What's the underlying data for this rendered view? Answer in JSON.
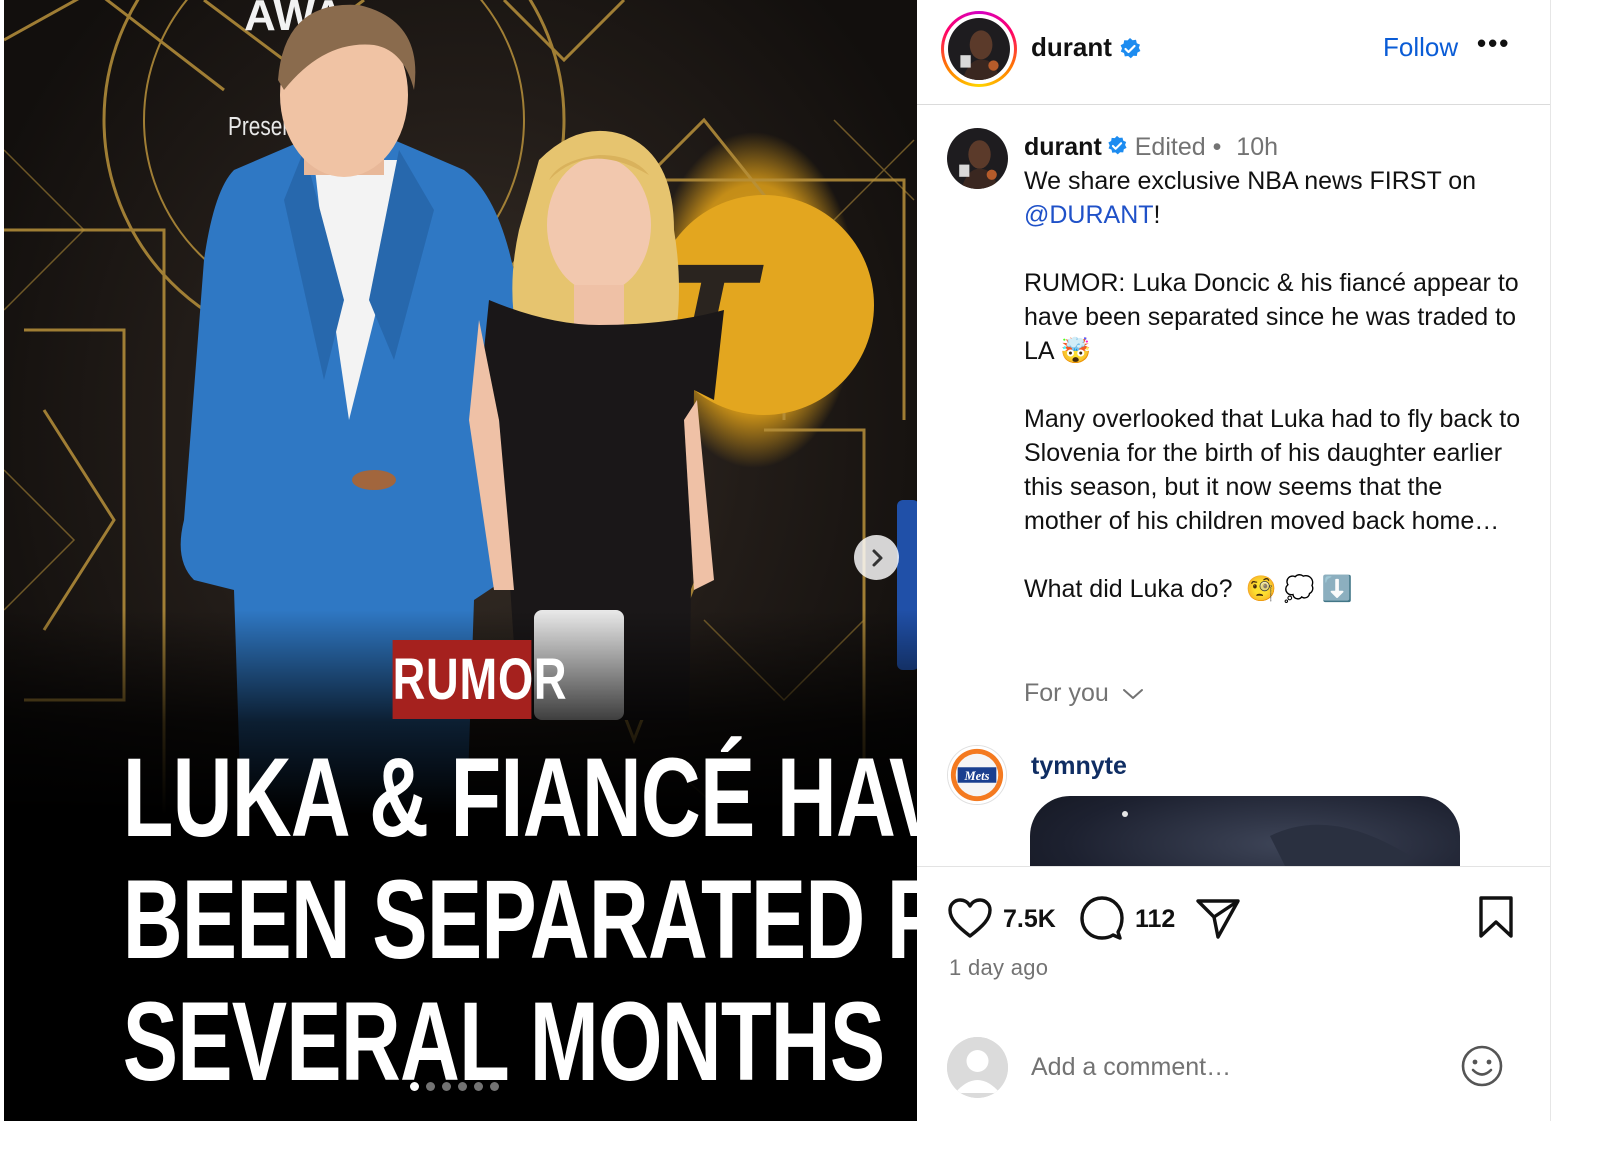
{
  "post": {
    "badge": "RUMOR",
    "headline": [
      "LUKA & FIANCÉ HAVE",
      "BEEN SEPARATED FOR",
      "SEVERAL MONTHS"
    ],
    "slide_count": 6,
    "active_slide": 1,
    "icons": {
      "next": "chevron-right-icon"
    }
  },
  "header": {
    "username": "durant",
    "follow_label": "Follow",
    "more_label": "•••"
  },
  "caption": {
    "username": "durant",
    "edited": "Edited",
    "separator": "•",
    "time": "10h",
    "line1": "We share exclusive NBA news FIRST on",
    "mention": "@DURANT",
    "line1_tail": "!",
    "para2": "RUMOR: Luka Doncic & his fiancé appear to have been separated since he was traded to LA",
    "para2_emoji": "🤯",
    "para3": "Many overlooked that Luka had to fly back to Slovenia for the birth of his daughter earlier this season, but it now seems that the mother of his children moved back home…",
    "para4": "What did Luka do?",
    "para4_emojis": "🧐 💭 ⬇️"
  },
  "for_you": {
    "label": "For you"
  },
  "comment": {
    "username": "tymnyte"
  },
  "actions": {
    "likes": "7.5K",
    "comments": "112",
    "date": "1 day ago"
  },
  "composer": {
    "placeholder": "Add a comment…"
  },
  "colors": {
    "link_blue": "#0a5cd6",
    "badge_red": "#a5211e",
    "muted": "#737373"
  }
}
